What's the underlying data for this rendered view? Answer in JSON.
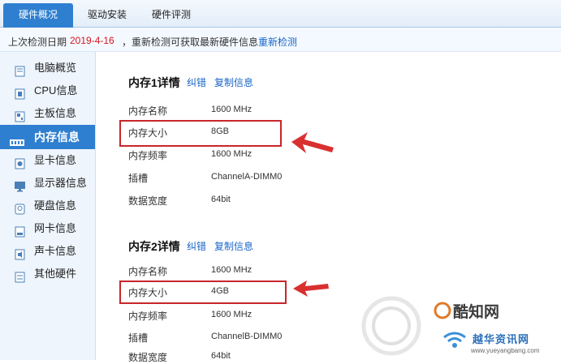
{
  "tabs": [
    {
      "label": "硬件概况"
    },
    {
      "label": "驱动安装"
    },
    {
      "label": "硬件评测"
    }
  ],
  "infobar": {
    "prefix": "上次检测日期",
    "date": "2019-4-16",
    "suffix": "，重新检测可获取最新硬件信息",
    "redetect": "重新检测"
  },
  "sidebar": {
    "items": [
      {
        "label": "电脑概览",
        "icon": "monitor-page-icon"
      },
      {
        "label": "CPU信息",
        "icon": "cpu-icon"
      },
      {
        "label": "主板信息",
        "icon": "motherboard-icon"
      },
      {
        "label": "内存信息",
        "icon": "memory-icon"
      },
      {
        "label": "显卡信息",
        "icon": "gpu-icon"
      },
      {
        "label": "显示器信息",
        "icon": "display-icon"
      },
      {
        "label": "硬盘信息",
        "icon": "disk-icon"
      },
      {
        "label": "网卡信息",
        "icon": "network-card-icon"
      },
      {
        "label": "声卡信息",
        "icon": "sound-card-icon"
      },
      {
        "label": "其他硬件",
        "icon": "other-hardware-icon"
      }
    ],
    "active_index": 3
  },
  "sections": [
    {
      "title": "内存1详情",
      "links": [
        "纠错",
        "复制信息"
      ],
      "rows": [
        {
          "label": "内存名称",
          "value": "1600 MHz"
        },
        {
          "label": "内存大小",
          "value": "8GB"
        },
        {
          "label": "内存频率",
          "value": "1600 MHz"
        },
        {
          "label": "插槽",
          "value": "ChannelA-DIMM0"
        },
        {
          "label": "数据宽度",
          "value": "64bit"
        }
      ]
    },
    {
      "title": "内存2详情",
      "links": [
        "纠错",
        "复制信息"
      ],
      "rows": [
        {
          "label": "内存名称",
          "value": "1600 MHz"
        },
        {
          "label": "内存大小",
          "value": "4GB"
        },
        {
          "label": "内存频率",
          "value": "1600 MHz"
        },
        {
          "label": "插槽",
          "value": "ChannelB-DIMM0"
        },
        {
          "label": "数据宽度",
          "value": "64bit"
        }
      ]
    }
  ],
  "watermark": {
    "text1": "酷知网",
    "text2": "越华资讯网",
    "url": "www.yueyangbang.com"
  },
  "colors": {
    "accent": "#2f7fd0",
    "highlight": "#c8262b",
    "link": "#1a66c7",
    "date": "#d4161c"
  }
}
